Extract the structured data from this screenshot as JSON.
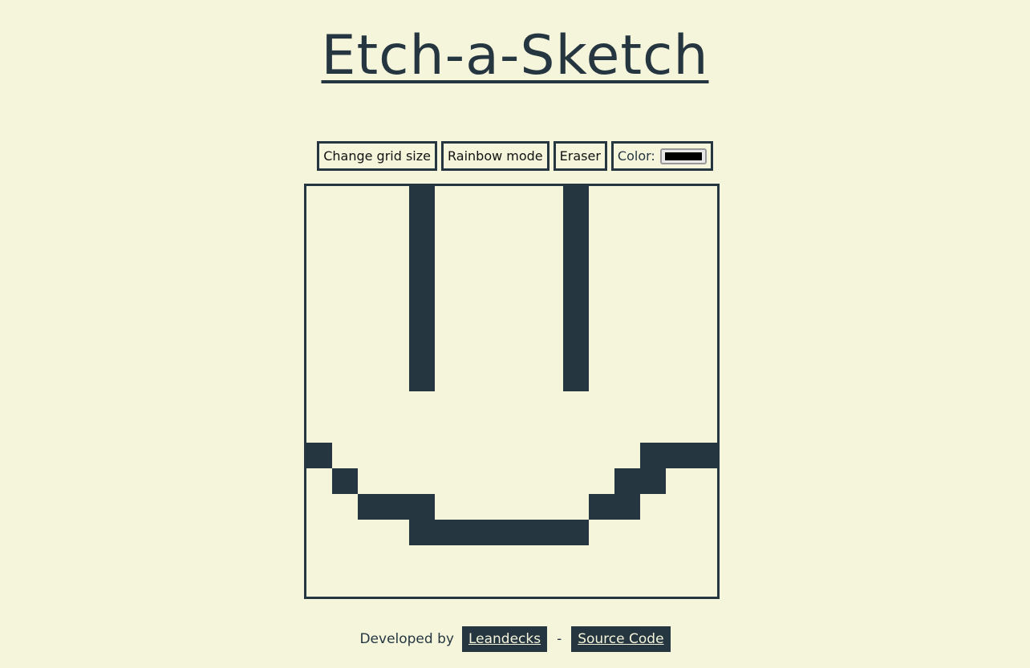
{
  "header": {
    "title": "Etch-a-Sketch"
  },
  "controls": {
    "grid_size_label": "Change grid size",
    "rainbow_label": "Rainbow mode",
    "eraser_label": "Eraser",
    "color_label": "Color:",
    "color_value": "#000000"
  },
  "colors": {
    "background": "#f5f5dc",
    "ink": "#253640"
  },
  "grid": {
    "size": 16,
    "filled_cells": [
      [
        0,
        4
      ],
      [
        1,
        4
      ],
      [
        2,
        4
      ],
      [
        3,
        4
      ],
      [
        4,
        4
      ],
      [
        5,
        4
      ],
      [
        6,
        4
      ],
      [
        7,
        4
      ],
      [
        0,
        10
      ],
      [
        1,
        10
      ],
      [
        2,
        10
      ],
      [
        3,
        10
      ],
      [
        4,
        10
      ],
      [
        5,
        10
      ],
      [
        6,
        10
      ],
      [
        7,
        10
      ],
      [
        10,
        0
      ],
      [
        10,
        13
      ],
      [
        10,
        14
      ],
      [
        10,
        15
      ],
      [
        11,
        1
      ],
      [
        11,
        12
      ],
      [
        11,
        13
      ],
      [
        12,
        2
      ],
      [
        12,
        3
      ],
      [
        12,
        4
      ],
      [
        12,
        11
      ],
      [
        12,
        12
      ],
      [
        13,
        4
      ],
      [
        13,
        5
      ],
      [
        13,
        6
      ],
      [
        13,
        7
      ],
      [
        13,
        8
      ],
      [
        13,
        9
      ],
      [
        13,
        10
      ]
    ]
  },
  "footer": {
    "developed_by": "Developed by",
    "author_link": "Leandecks",
    "separator": "-",
    "source_link": "Source Code"
  }
}
